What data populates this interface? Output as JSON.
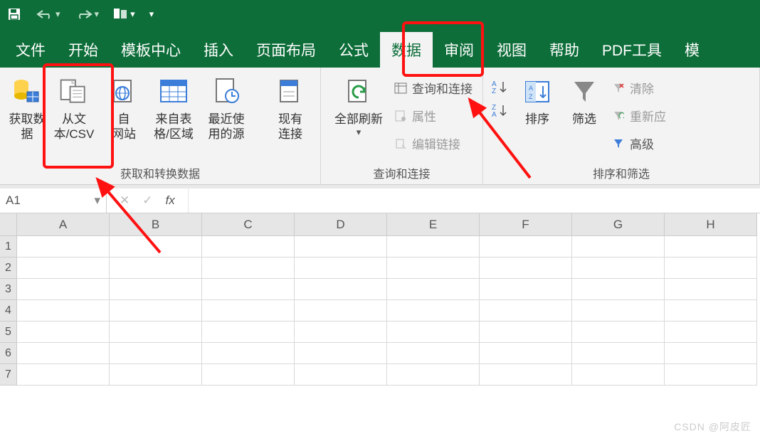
{
  "titlebar": {
    "save": "💾",
    "undo": "↶",
    "redo": "↷"
  },
  "tabs": {
    "file": "文件",
    "home": "开始",
    "templates": "模板中心",
    "insert": "插入",
    "layout": "页面布局",
    "formulas": "公式",
    "data": "数据",
    "review": "审阅",
    "view": "视图",
    "help": "帮助",
    "pdf": "PDF工具",
    "more": "模"
  },
  "ribbon": {
    "getdata": {
      "label": "获取数\n据",
      "fromcsv": "从文\n本/CSV",
      "fromweb": "自\n网站",
      "fromtable": "来自表\n格/区域",
      "recent": "最近使\n用的源",
      "existing": "现有\n连接",
      "group": "获取和转换数据"
    },
    "queries": {
      "refresh": "全部刷新",
      "qconn": "查询和连接",
      "props": "属性",
      "editlinks": "编辑链接",
      "group": "查询和连接"
    },
    "sort": {
      "sortbtn": "排序",
      "filterbtn": "筛选",
      "clear": "清除",
      "reapply": "重新应",
      "advanced": "高级",
      "group": "排序和筛选"
    }
  },
  "namebox": {
    "value": "A1"
  },
  "fx": {
    "label": "fx"
  },
  "cols": [
    "A",
    "B",
    "C",
    "D",
    "E",
    "F",
    "G",
    "H"
  ],
  "rows": [
    "1",
    "2",
    "3",
    "4",
    "5",
    "6",
    "7"
  ],
  "watermark": "CSDN @阿皮匠"
}
